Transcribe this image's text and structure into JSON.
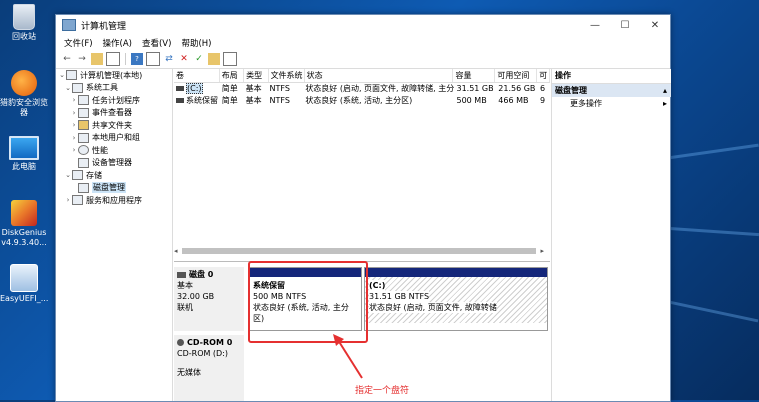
{
  "desktop": {
    "icons": [
      {
        "label": "回收站",
        "icon": "recycle-bin-icon"
      },
      {
        "label": "猎豹安全浏览器",
        "icon": "browser-icon"
      },
      {
        "label": "此电脑",
        "icon": "computer-icon"
      },
      {
        "label": "DiskGenius v4.9.3.40...",
        "icon": "diskgenius-icon"
      },
      {
        "label": "EasyUEFI_...",
        "icon": "easyuefi-icon"
      }
    ]
  },
  "window": {
    "title": "计算机管理",
    "controls": {
      "minimize": "—",
      "maximize": "☐",
      "close": "✕"
    },
    "menu": [
      "文件(F)",
      "操作(A)",
      "查看(V)",
      "帮助(H)"
    ]
  },
  "tree": {
    "items": [
      {
        "label": "计算机管理(本地)",
        "expanded": true
      },
      {
        "label": "系统工具",
        "expanded": true
      },
      {
        "label": "任务计划程序"
      },
      {
        "label": "事件查看器"
      },
      {
        "label": "共享文件夹"
      },
      {
        "label": "本地用户和组"
      },
      {
        "label": "性能"
      },
      {
        "label": "设备管理器"
      },
      {
        "label": "存储",
        "expanded": true
      },
      {
        "label": "磁盘管理",
        "selected": true
      },
      {
        "label": "服务和应用程序"
      }
    ]
  },
  "volumes": {
    "columns": [
      "卷",
      "布局",
      "类型",
      "文件系统",
      "状态",
      "容量",
      "可用空间",
      "可"
    ],
    "rows": [
      [
        "(C:)",
        "简单",
        "基本",
        "NTFS",
        "状态良好 (启动, 页面文件, 故障转储, 主分区)",
        "31.51 GB",
        "21.56 GB",
        "6"
      ],
      [
        "系统保留",
        "简单",
        "基本",
        "NTFS",
        "状态良好 (系统, 活动, 主分区)",
        "500 MB",
        "466 MB",
        "9"
      ]
    ]
  },
  "disks": {
    "disk0": {
      "name": "磁盘 0",
      "type": "基本",
      "size": "32.00 GB",
      "status": "联机"
    },
    "cdrom": {
      "name": "CD-ROM 0",
      "drive": "CD-ROM (D:)",
      "media": "无媒体"
    },
    "partitions": [
      {
        "name": "系统保留",
        "size": "500 MB NTFS",
        "status": "状态良好 (系统, 活动, 主分区)"
      },
      {
        "name": "(C:)",
        "size": "31.51 GB NTFS",
        "status": "状态良好 (启动, 页面文件, 故障转储"
      }
    ]
  },
  "actions": {
    "header": "操作",
    "section": "磁盘管理",
    "more": "更多操作"
  },
  "annotation": {
    "text": "指定一个盘符",
    "color": "#e53030"
  }
}
